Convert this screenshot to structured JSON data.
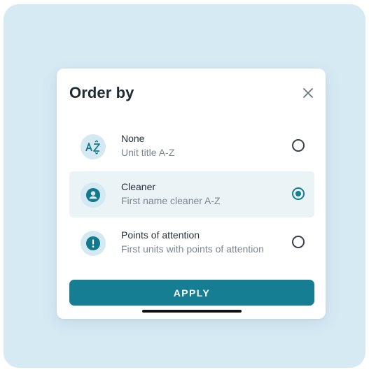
{
  "dialog": {
    "title": "Order by",
    "close_icon": "close-icon",
    "options": [
      {
        "title": "None",
        "subtitle": "Unit title A-Z",
        "icon": "sort-az-icon",
        "selected": false
      },
      {
        "title": "Cleaner",
        "subtitle": "First name cleaner A-Z",
        "icon": "person-icon",
        "selected": true
      },
      {
        "title": "Points of attention",
        "subtitle": "First units with points of attention",
        "icon": "alert-icon",
        "selected": false
      }
    ],
    "apply_label": "APPLY"
  },
  "colors": {
    "background_frame": "#d6eaf4",
    "accent": "#157e92",
    "icon_bg": "#d4e9f1",
    "selected_row_bg": "#eaf3f6",
    "title_text": "#1f2a33",
    "subtitle_text": "#7a8891"
  }
}
